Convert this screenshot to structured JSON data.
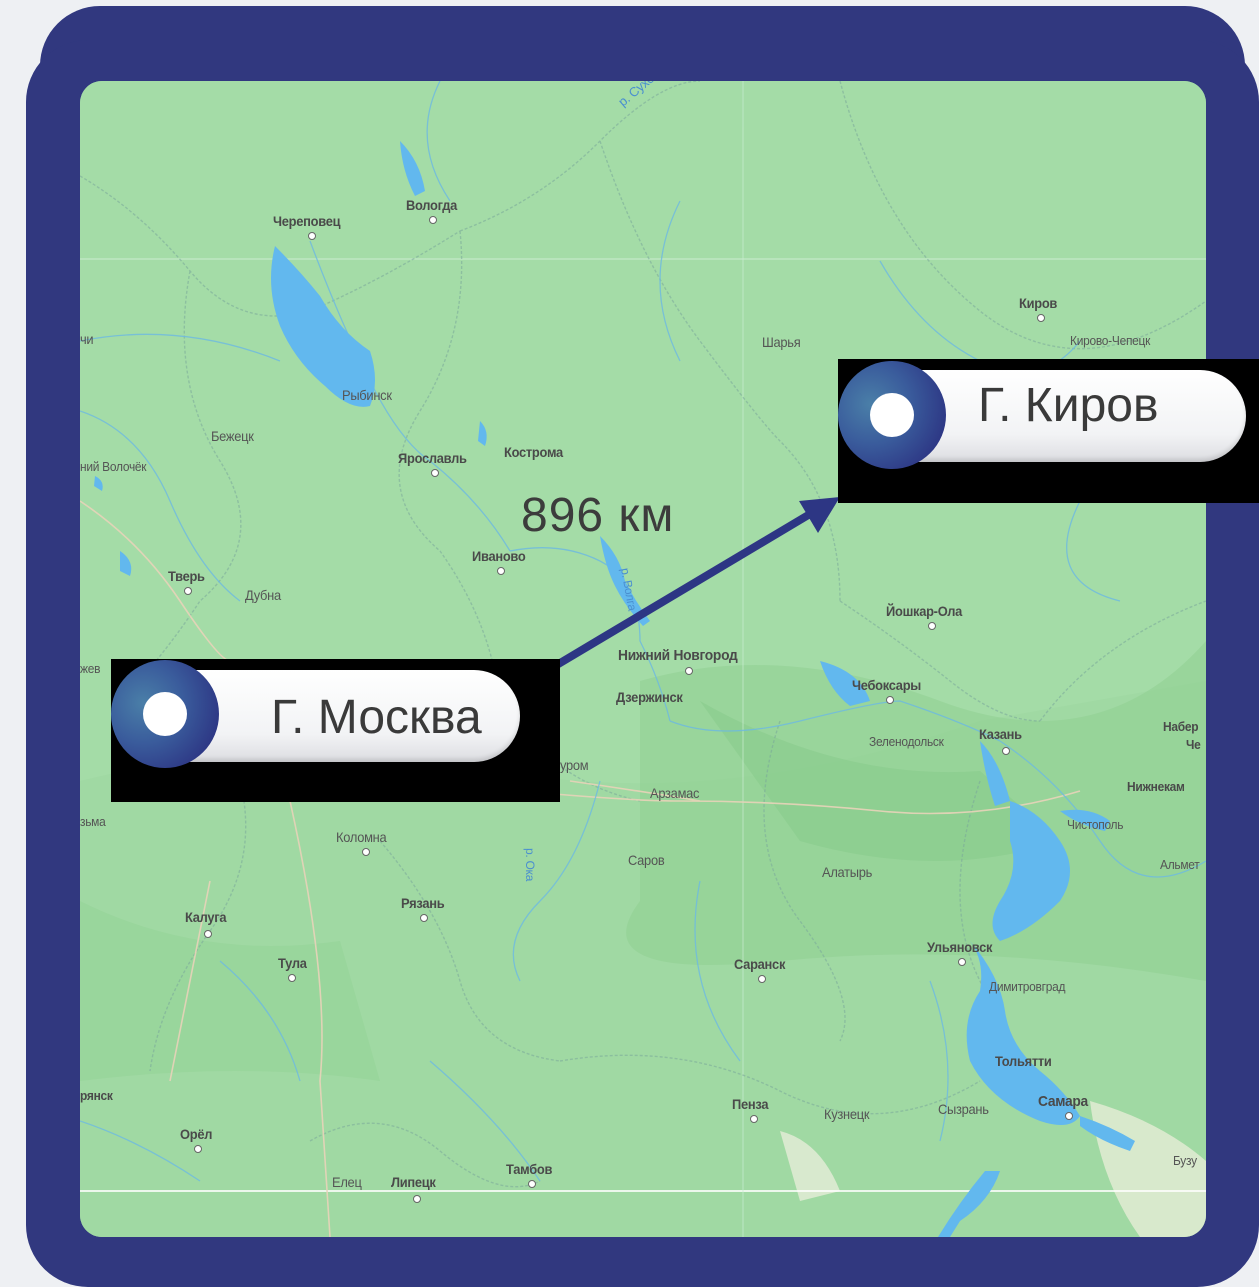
{
  "origin": {
    "label": "Г. Москва"
  },
  "destination": {
    "label": "Г. Киров"
  },
  "distance": "896 км",
  "colors": {
    "frame": "#31387f",
    "map_land": "#a3dba6",
    "water": "#62b8ee",
    "arrow": "#2d3684"
  },
  "map_labels": {
    "cherepovets": "Череповец",
    "vologda": "Вологда",
    "kirov": "Киров",
    "kirovo_chepetsk": "Кирово-Чепецк",
    "sharya": "Шарья",
    "rybinsk": "Рыбинск",
    "bezhetsk": "Бежецк",
    "volochek": "ний Волочёк",
    "yaroslavl": "Ярославль",
    "kostroma": "Кострома",
    "ivanovo": "Иваново",
    "tver": "Тверь",
    "dubna": "Дубна",
    "yoshkar_ola": "Йошкар-Ола",
    "nizhny": "Нижний Новгород",
    "dzerzhinsk": "Дзержинск",
    "cheboksary": "Чебоксары",
    "zelenodolsk": "Зеленодольск",
    "kazan": "Казань",
    "naber": "Набер",
    "che": "Че",
    "nizhnekam": "Нижнекам",
    "chistopol": "Чистополь",
    "almet": "Альмет",
    "arzamas": "Арзамас",
    "murom": "уром",
    "kolomna": "Коломна",
    "vyazma": "зьма",
    "sarov": "Саров",
    "alatyr": "Алатырь",
    "kaluga": "Калуга",
    "ryazan": "Рязань",
    "tula": "Тула",
    "ulyanovsk": "Ульяновск",
    "dimitrovgrad": "Димитровград",
    "saransk": "Саранск",
    "tolyatti": "Тольятти",
    "samara": "Самара",
    "bryansk": "рянск",
    "penza": "Пенза",
    "kuznetsk": "Кузнецк",
    "syzran": "Сызрань",
    "orel": "Орёл",
    "elets": "Елец",
    "lipetsk": "Липецк",
    "tambov": "Тамбов",
    "buzu": "Бузу",
    "chi": "чи",
    "zhev": "жев",
    "sukhona": "р. Сухона",
    "volga": "р. Волга",
    "oka": "р. Ока"
  }
}
